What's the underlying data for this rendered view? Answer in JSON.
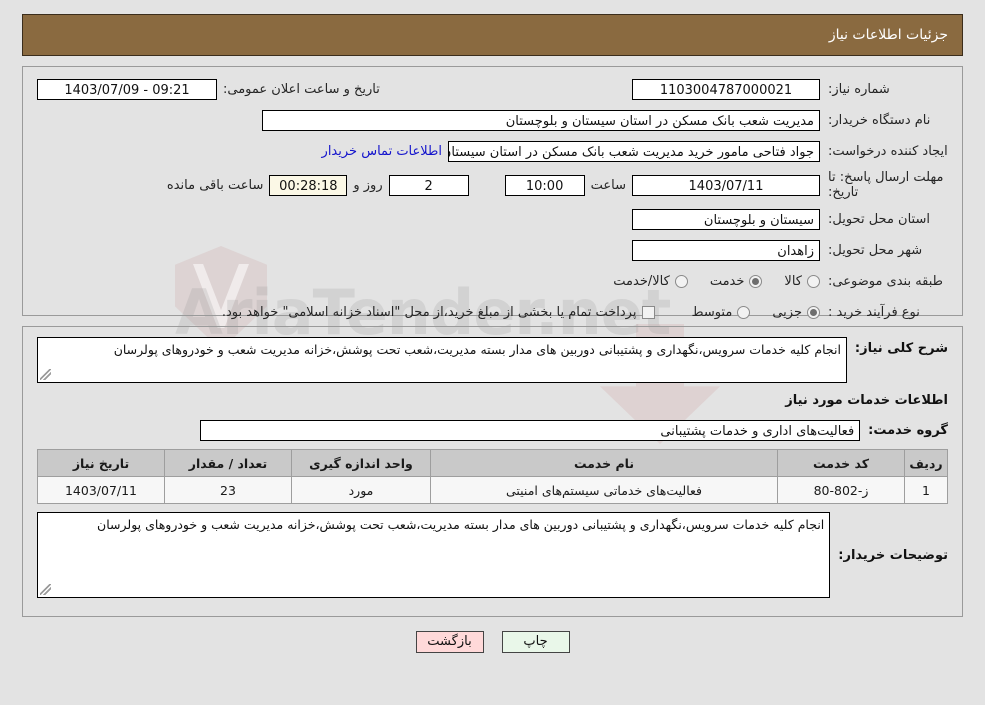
{
  "header": {
    "title": "جزئیات اطلاعات نیاز"
  },
  "colors": {
    "header_bar": "#8a6a40",
    "link": "#1414cc",
    "print_button": "#e9f7e9",
    "back_button": "#ffd9d9",
    "countdown_box": "#fbf8e6",
    "table_header": "#c9c9c9"
  },
  "watermark": {
    "text": "AriaTender.net"
  },
  "info": {
    "need_number_label": "شماره نیاز:",
    "need_number_value": "1103004787000021",
    "announce_label": "تاریخ و ساعت اعلان عمومی:",
    "announce_value": "09:21 - 1403/07/09",
    "buyer_org_label": "نام دستگاه خریدار:",
    "buyer_org_value": "مدیریت شعب بانک مسکن در استان سیستان و بلوچستان",
    "creator_label": "ایجاد کننده درخواست:",
    "creator_value": "جواد  فتاحی مامور خرید مدیریت شعب بانک مسکن در استان سیستان و بلوچستان",
    "contact_link": "اطلاعات تماس خریدار",
    "deadline_label": "مهلت ارسال پاسخ: تا تاریخ:",
    "deadline_date": "1403/07/11",
    "hour_label": "ساعت",
    "deadline_hour": "10:00",
    "days_value": "2",
    "days_label": "روز و",
    "countdown_value": "00:28:18",
    "remaining_label": "ساعت باقی مانده",
    "province_label": "استان محل تحویل:",
    "province_value": "سیستان و بلوچستان",
    "city_label": "شهر محل تحویل:",
    "city_value": "زاهدان",
    "category_label": "طبقه بندی موضوعی:",
    "category_options": [
      {
        "label": "کالا",
        "selected": false
      },
      {
        "label": "خدمت",
        "selected": true
      },
      {
        "label": "کالا/خدمت",
        "selected": false
      }
    ],
    "process_label": "نوع فرآیند خرید :",
    "process_options": [
      {
        "label": "جزیی",
        "selected": true
      },
      {
        "label": "متوسط",
        "selected": false
      }
    ],
    "treasury_checkbox_checked": false,
    "treasury_note": "پرداخت تمام یا بخشی از مبلغ خرید،از محل \"اسناد خزانه اسلامی\" خواهد بود."
  },
  "summary": {
    "label": "شرح کلی نیاز:",
    "value": "انجام کلیه خدمات سرویس،نگهداری و پشتیبانی دوربین های مدار بسته مدیریت،شعب تحت پوشش،خزانه مدیریت شعب و خودروهای پولرسان"
  },
  "services": {
    "section_title": "اطلاعات خدمات مورد نیاز",
    "group_label": "گروه خدمت:",
    "group_value": "فعالیت‌های اداری و خدمات پشتیبانی",
    "columns": [
      "ردیف",
      "کد خدمت",
      "نام خدمت",
      "واحد اندازه گیری",
      "تعداد / مقدار",
      "تاریخ نیاز"
    ],
    "rows": [
      {
        "row_no": "1",
        "service_code": "ز-802-80",
        "service_name": "فعالیت‌های خدماتی سیستم‌های امنیتی",
        "unit": "مورد",
        "quantity": "23",
        "need_date": "1403/07/11"
      }
    ]
  },
  "buyer_notes": {
    "label": "توضیحات خریدار:",
    "value": "انجام کلیه خدمات سرویس،نگهداری و پشتیبانی دوربین های مدار بسته مدیریت،شعب تحت پوشش،خزانه مدیریت شعب و خودروهای پولرسان"
  },
  "footer": {
    "print_label": "چاپ",
    "back_label": "بازگشت"
  }
}
